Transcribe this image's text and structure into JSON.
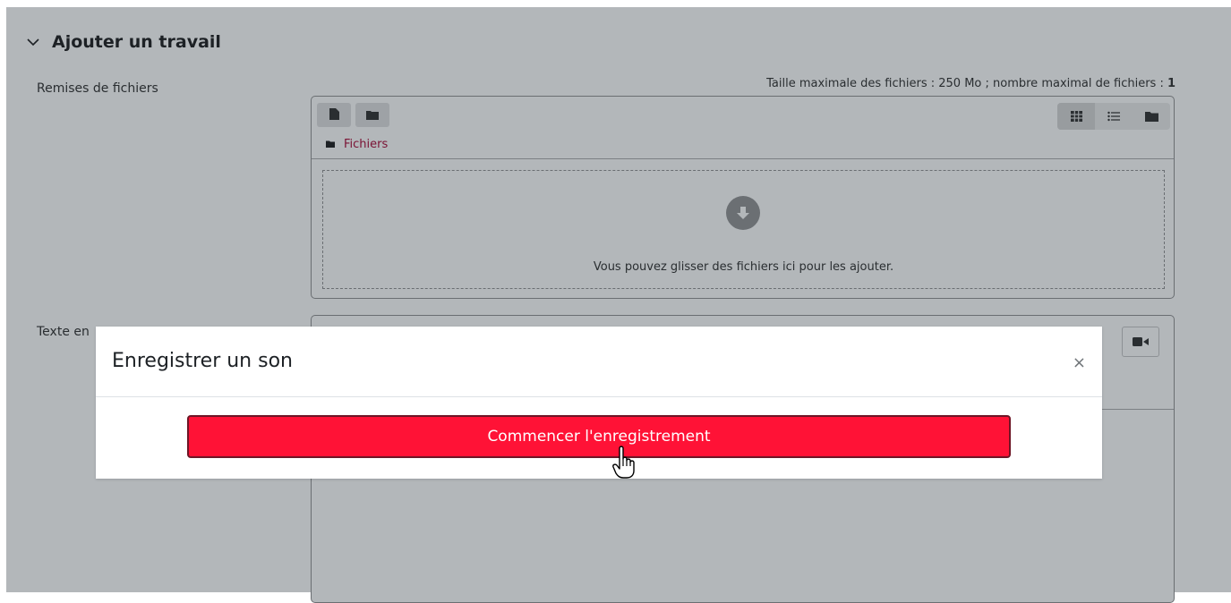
{
  "section": {
    "title": "Ajouter un travail",
    "chevron_icon": "chevron-down-icon"
  },
  "labels": {
    "file_submissions": "Remises de fichiers",
    "online_text": "Texte en"
  },
  "filepicker": {
    "size_info": "Taille maximale des fichiers : 250 Mo ; nombre maximal de fichiers : ",
    "max_files": "1",
    "buttons": [
      "add-file-icon",
      "create-folder-icon"
    ],
    "views": [
      "grid-view-icon",
      "list-view-icon",
      "tree-view-icon"
    ],
    "path_label": "Fichiers",
    "drop_text": "Vous pouvez glisser des fichiers ici pour les ajouter."
  },
  "modal": {
    "title": "Enregistrer un son",
    "close_label": "×",
    "record_button": "Commencer l'enregistrement"
  },
  "colors": {
    "accent": "#ff1236",
    "overlay": "#b3b7ba",
    "link": "#7a1234"
  }
}
